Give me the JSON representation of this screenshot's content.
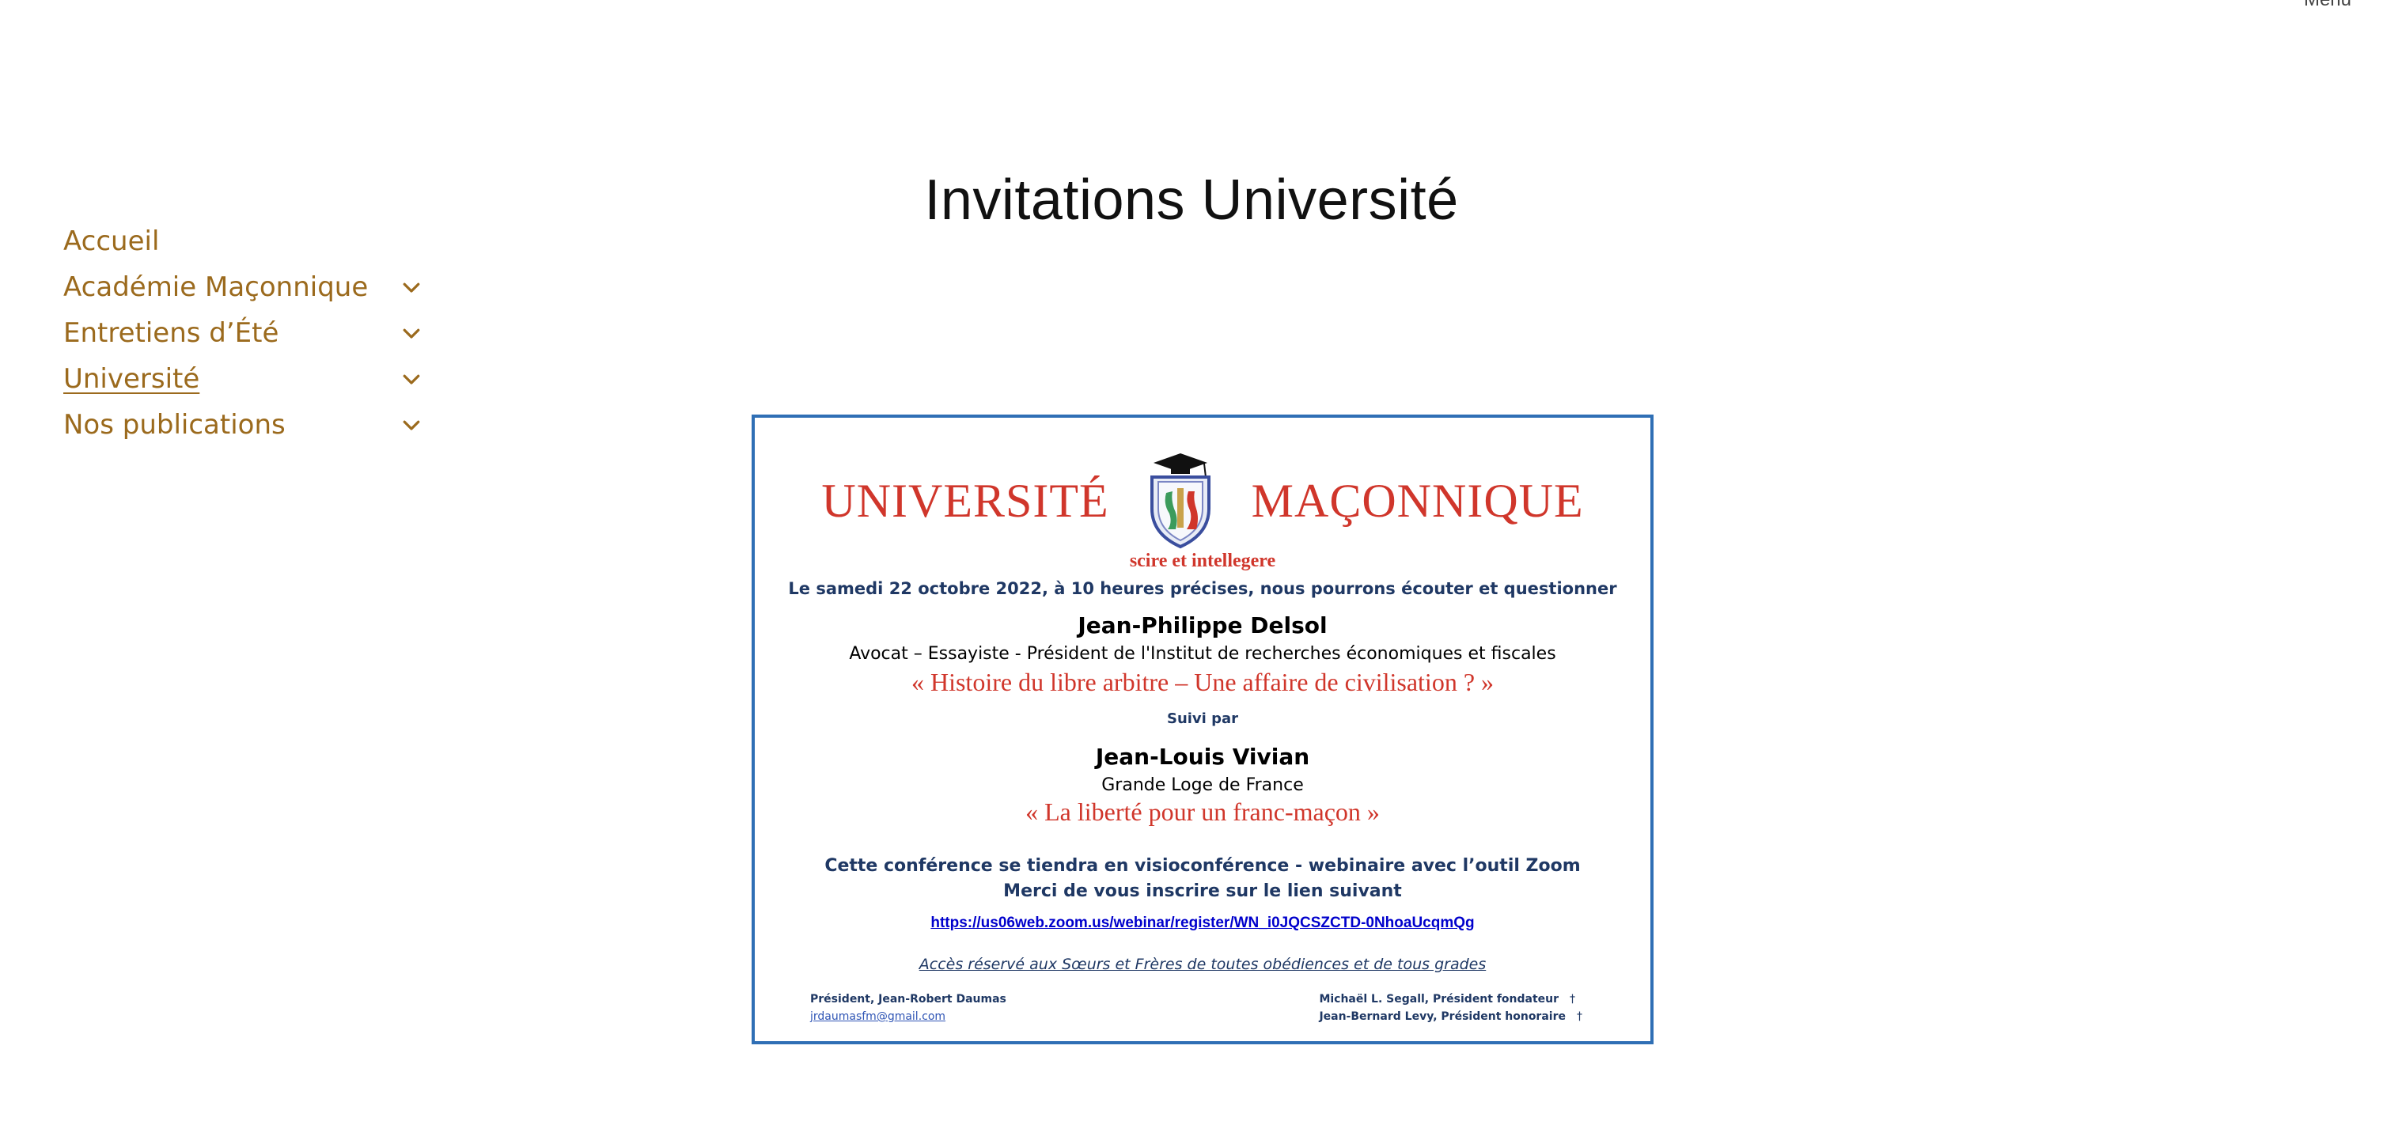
{
  "header": {
    "menu_label": "Menu"
  },
  "nav": {
    "items": [
      {
        "label": "Accueil",
        "has_submenu": false
      },
      {
        "label": "Académie Maçonnique",
        "has_submenu": true
      },
      {
        "label": "Entretiens d’Été",
        "has_submenu": true
      },
      {
        "label": "Université",
        "has_submenu": true,
        "current": true
      },
      {
        "label": "Nos publications",
        "has_submenu": true
      }
    ],
    "link_color": "#9b6a1d"
  },
  "page": {
    "title": "Invitations Université"
  },
  "invitation": {
    "header_left": "UNIVERSITÉ",
    "header_right": "MAÇONNIQUE",
    "motto": "scire et intellegere",
    "date_line": "Le samedi 22 octobre 2022, à 10 heures précises, nous pourrons écouter et questionner",
    "speaker1": "Jean-Philippe Delsol",
    "speaker1_role": "Avocat – Essayiste - Président de l'Institut de recherches économiques et fiscales",
    "talk1": "« Histoire du libre arbitre – Une affaire de civilisation ? »",
    "followed_by": "Suivi par",
    "speaker2": "Jean-Louis Vivian",
    "speaker2_role": "Grande Loge de France",
    "talk2": "« La liberté pour un franc-maçon »",
    "conference_line1": "Cette conférence se tiendra en visioconférence - webinaire avec l’outil Zoom",
    "conference_line2": "Merci de vous inscrire sur le lien suivant",
    "zoom_link": "https://us06web.zoom.us/webinar/register/WN_i0JQCSZCTD-0NhoaUcqmQg",
    "access_note": "Accès réservé aux Sœurs et Frères de toutes obédiences et de tous grades",
    "footer_left_name": "Président, Jean-Robert Daumas",
    "footer_left_email": "jrdaumasfm@gmail.com",
    "footer_right_1": "Michaël L. Segall, Président fondateur",
    "footer_right_2": "Jean-Bernard Levy, Président honoraire",
    "cross_symbol": "†",
    "crest_icon": "university-crest-icon",
    "accent_red": "#d0362b",
    "accent_navy": "#1f3864",
    "border_color": "#2f6fb5"
  }
}
